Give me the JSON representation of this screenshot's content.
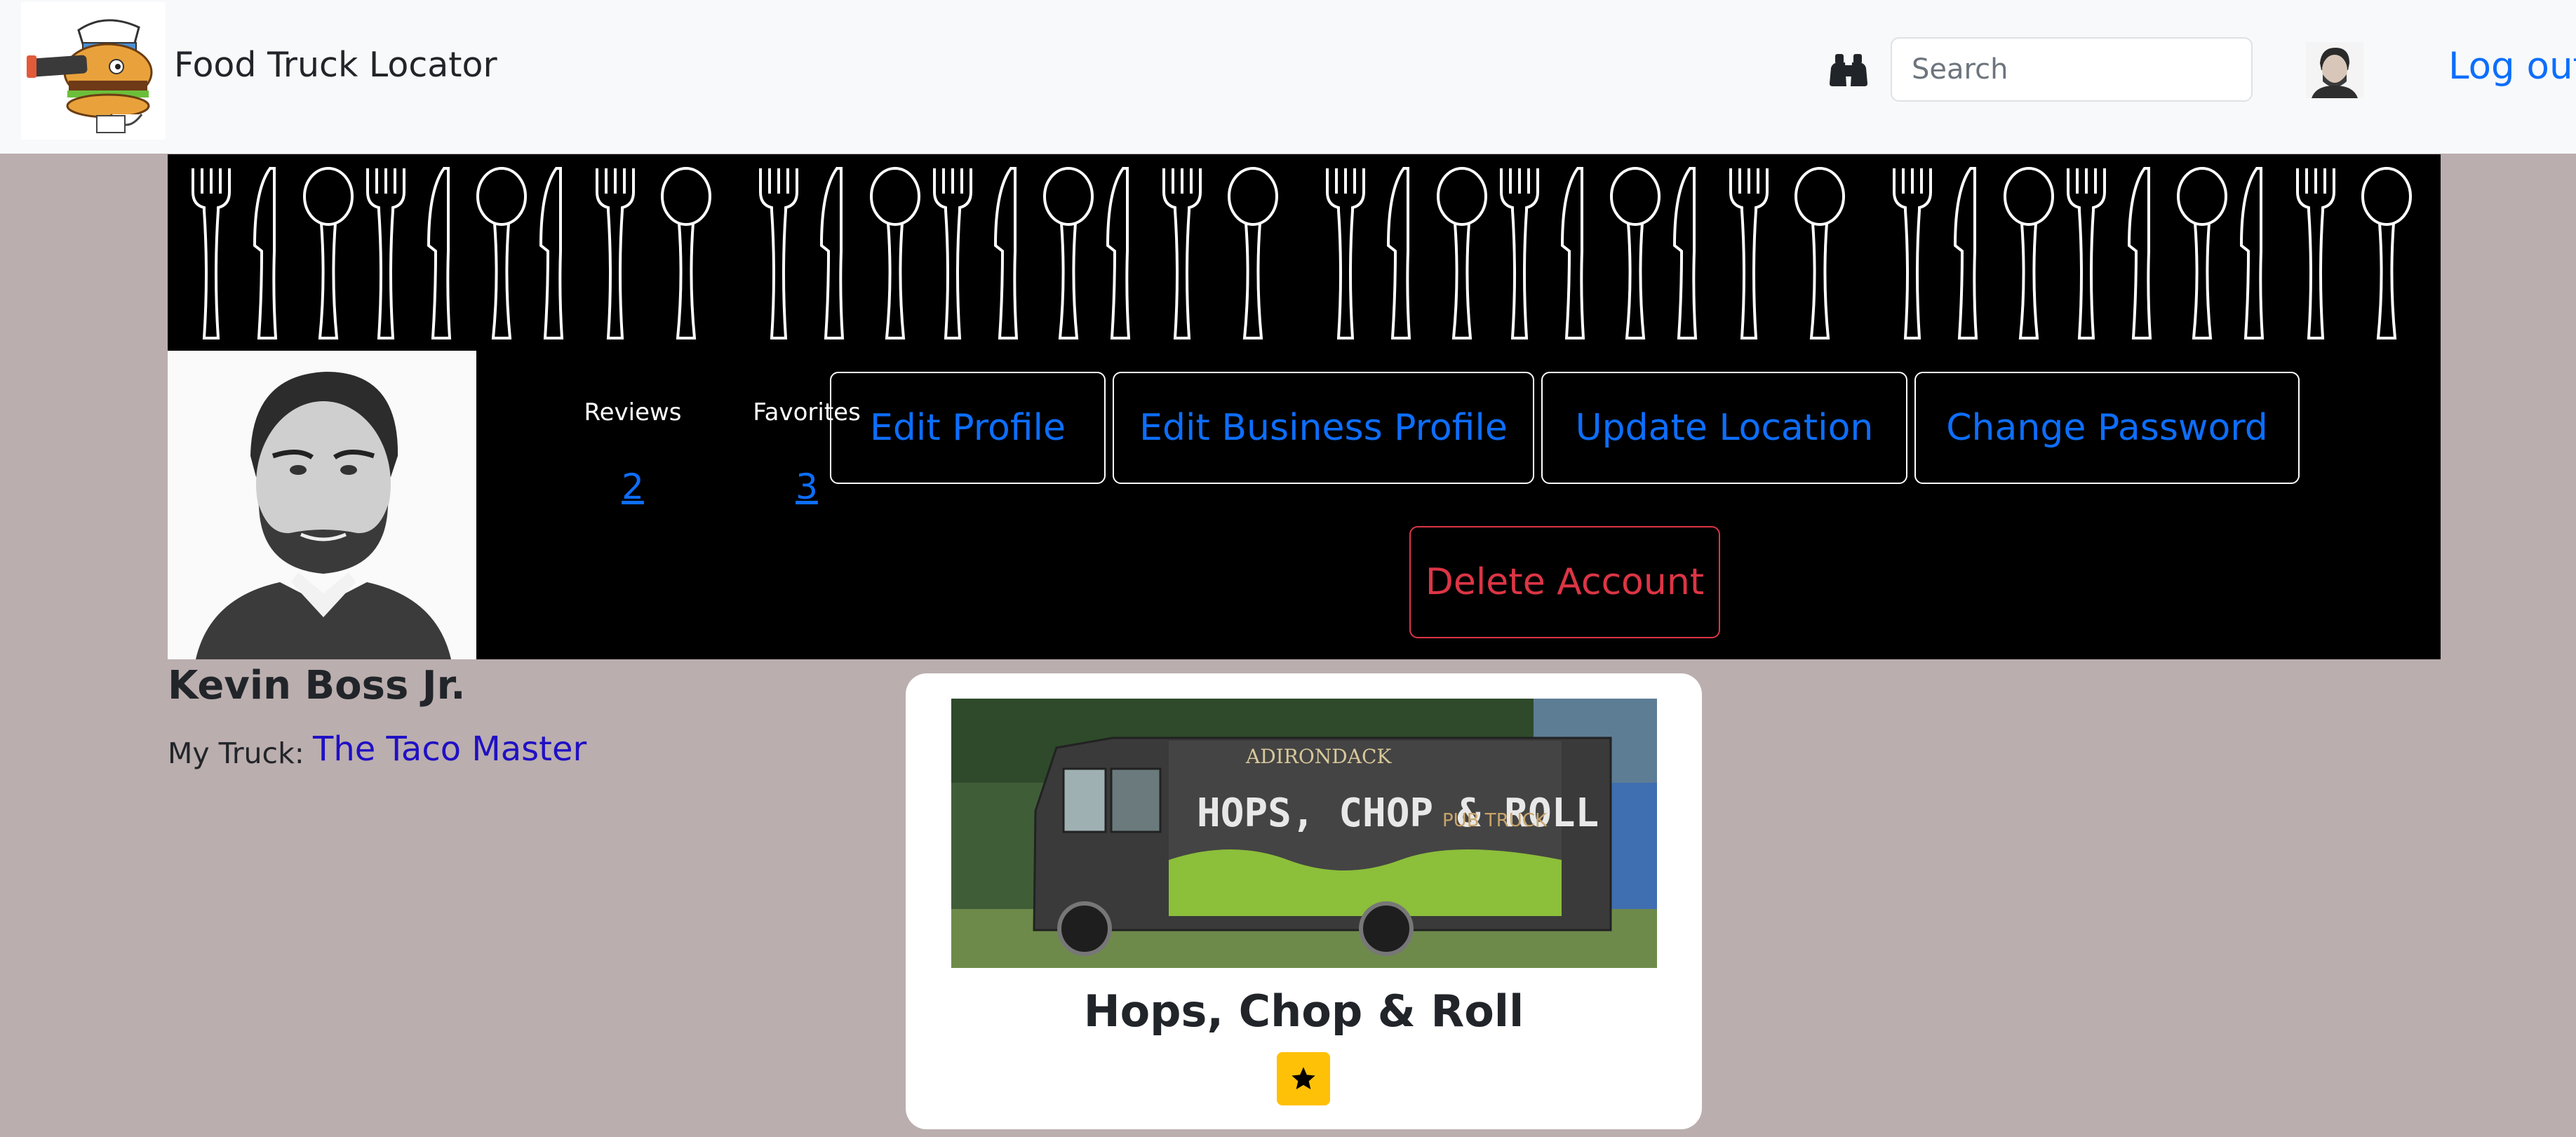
{
  "navbar": {
    "brand": "Food Truck Locator",
    "search_placeholder": "Search",
    "logout": "Log out",
    "icons": {
      "logo": "burger-sailor-logo",
      "search": "binoculars-icon",
      "avatar": "user-avatar"
    }
  },
  "profile": {
    "stats": [
      {
        "label": "Reviews",
        "value": "2"
      },
      {
        "label": "Favorites",
        "value": "3"
      }
    ],
    "buttons": {
      "edit_profile": "Edit Profile",
      "edit_business_profile": "Edit Business Profile",
      "update_location": "Update Location",
      "change_password": "Change Password",
      "delete_account": "Delete Account"
    },
    "name": "Kevin Boss Jr.",
    "truck_label": "My Truck:",
    "truck_name": "The Taco Master"
  },
  "favorite_card": {
    "title": "Hops, Chop & Roll",
    "truck_photo_text": {
      "brand": "ADIRONDACK",
      "headline": "HOPS, CHOP & ROLL",
      "subline": "PUB TRUCK"
    },
    "star_icon": "star-icon"
  },
  "colors": {
    "page_bg": "#bbaeae",
    "navbar_bg": "#f8f9fa",
    "link": "#0d6efd",
    "danger": "#dc3545",
    "warning": "#ffc107",
    "truck_link": "#1f10c4"
  }
}
